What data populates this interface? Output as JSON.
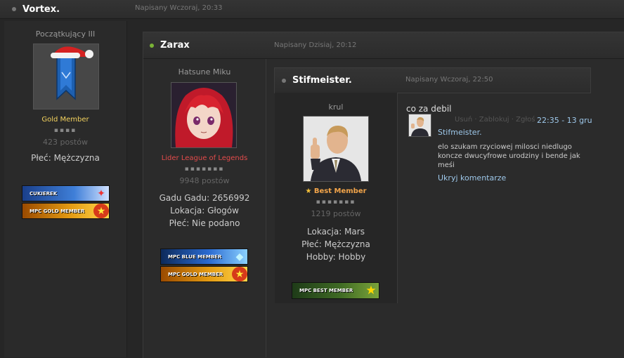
{
  "post1": {
    "author": "Vortex.",
    "date": "Napisany Wczoraj, 20:33",
    "rank_title": "Początkujący III",
    "group": "Gold Member",
    "pips": "▪▪▪▪",
    "posts": "423 postów",
    "gender_line": "Płeć: Mężczyzna",
    "badges": [
      {
        "label": "CUKIEREK",
        "icon": "candy-cane-icon"
      },
      {
        "label": "MPC GOLD MEMBER",
        "icon": "star-icon"
      }
    ]
  },
  "post2": {
    "author": "Zarax",
    "date": "Napisany Dzisiaj, 20:12",
    "rank_title": "Hatsune Miku",
    "group": "Lider League of Legends",
    "pips": "▪▪▪▪▪▪▪",
    "posts": "9948 postów",
    "info": [
      "Gadu Gadu: 2656992",
      "Lokacja: Głogów",
      "Płeć: Nie podano"
    ],
    "badges": [
      {
        "label": "MPC BLUE MEMBER",
        "icon": "diamond-icon"
      },
      {
        "label": "MPC GOLD MEMBER",
        "icon": "star-icon"
      }
    ]
  },
  "post3": {
    "author": "Stifmeister.",
    "date": "Napisany Wczoraj, 22:50",
    "rank_title": "krul",
    "group": "Best Member",
    "pips": "▪▪▪▪▪▪▪",
    "posts": "1219 postów",
    "info": [
      "Lokacja: Mars",
      "Płeć: Mężczyzna",
      "Hobby: Hobby"
    ],
    "badges": [
      {
        "label": "MPC BEST MEMBER",
        "icon": "star-icon"
      }
    ],
    "message": "co za debil",
    "comment": {
      "actions": [
        "Usuń",
        "Zablokuj",
        "Zgłoś"
      ],
      "timestamp": "22:35 - 13 gru",
      "author": "Stifmeister.",
      "text": "elo szukam rzyciowej milosci niedlugo koncze dwucyfrowe urodziny i bende jak meśi",
      "toggle": "Ukryj komentarze"
    }
  },
  "colors": {
    "gold_group": "#f4d35e",
    "leader_group": "#e44b4b",
    "best_group": "#f3a54a",
    "online": "#7ab336",
    "link": "#9ec8ea"
  }
}
